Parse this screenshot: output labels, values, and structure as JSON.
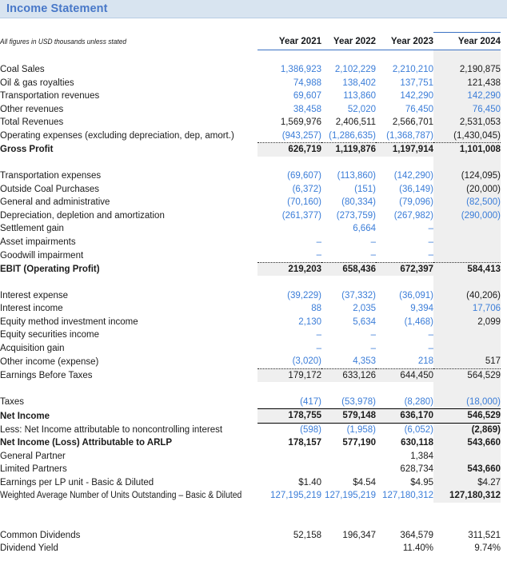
{
  "header": {
    "title": "Income Statement",
    "note": "All figures in USD thousands unless stated",
    "columns": [
      "Year 2021",
      "Year 2022",
      "Year 2023",
      "Year 2024"
    ]
  },
  "colors": {
    "title_text": "#4878c8",
    "title_band": "#d8e4f0",
    "linked_value": "#3b7dd8",
    "hardcoded_value": "#1b1b1b",
    "shading": "#efefef",
    "header_rule": "#3b72c4"
  },
  "rows": [
    {
      "label": "Coal Sales",
      "values": [
        "1,386,923",
        "2,102,229",
        "2,210,210",
        "2,190,875"
      ],
      "value_colors": [
        "blue",
        "blue",
        "blue",
        "black"
      ]
    },
    {
      "label": "Oil & gas royalties",
      "values": [
        "74,988",
        "138,402",
        "137,751",
        "121,438"
      ],
      "value_colors": [
        "blue",
        "blue",
        "blue",
        "black"
      ]
    },
    {
      "label": "Transportation revenues",
      "values": [
        "69,607",
        "113,860",
        "142,290",
        "142,290"
      ],
      "value_colors": [
        "blue",
        "blue",
        "blue",
        "blue"
      ]
    },
    {
      "label": "Other revenues",
      "values": [
        "38,458",
        "52,020",
        "76,450",
        "76,450"
      ],
      "value_colors": [
        "blue",
        "blue",
        "blue",
        "blue"
      ]
    },
    {
      "label": "Total Revenues",
      "values": [
        "1,569,976",
        "2,406,511",
        "2,566,701",
        "2,531,053"
      ],
      "value_colors": [
        "black",
        "black",
        "black",
        "black"
      ]
    },
    {
      "label": "Operating expenses (excluding depreciation, dep, amort.)",
      "values": [
        "(943,257)",
        "(1,286,635)",
        "(1,368,787)",
        "(1,430,045)"
      ],
      "value_colors": [
        "blue",
        "blue",
        "blue",
        "black"
      ]
    },
    {
      "label": "Gross Profit",
      "values": [
        "626,719",
        "1,119,876",
        "1,197,914",
        "1,101,008"
      ],
      "value_colors": [
        "black",
        "black",
        "black",
        "black"
      ]
    },
    {
      "label": "Transportation expenses",
      "values": [
        "(69,607)",
        "(113,860)",
        "(142,290)",
        "(124,095)"
      ],
      "value_colors": [
        "blue",
        "blue",
        "blue",
        "black"
      ]
    },
    {
      "label": "Outside Coal Purchases",
      "values": [
        "(6,372)",
        "(151)",
        "(36,149)",
        "(20,000)"
      ],
      "value_colors": [
        "blue",
        "blue",
        "blue",
        "black"
      ]
    },
    {
      "label": "General and administrative",
      "values": [
        "(70,160)",
        "(80,334)",
        "(79,096)",
        "(82,500)"
      ],
      "value_colors": [
        "blue",
        "blue",
        "blue",
        "blue"
      ]
    },
    {
      "label": "Depreciation, depletion and amortization",
      "values": [
        "(261,377)",
        "(273,759)",
        "(267,982)",
        "(290,000)"
      ],
      "value_colors": [
        "blue",
        "blue",
        "blue",
        "blue"
      ]
    },
    {
      "label": "Settlement gain",
      "values": [
        "",
        "6,664",
        "–",
        ""
      ],
      "value_colors": [
        "blue",
        "blue",
        "blue",
        "black"
      ]
    },
    {
      "label": "Asset impairments",
      "values": [
        "–",
        "–",
        "–",
        ""
      ],
      "value_colors": [
        "blue",
        "blue",
        "blue",
        "black"
      ]
    },
    {
      "label": "Goodwill impairment",
      "values": [
        "–",
        "–",
        "–",
        ""
      ],
      "value_colors": [
        "blue",
        "blue",
        "blue",
        "black"
      ]
    },
    {
      "label": "EBIT (Operating Profit)",
      "values": [
        "219,203",
        "658,436",
        "672,397",
        "584,413"
      ],
      "value_colors": [
        "black",
        "black",
        "black",
        "black"
      ]
    },
    {
      "label": "Interest expense",
      "values": [
        "(39,229)",
        "(37,332)",
        "(36,091)",
        "(40,206)"
      ],
      "value_colors": [
        "blue",
        "blue",
        "blue",
        "black"
      ]
    },
    {
      "label": "Interest income",
      "values": [
        "88",
        "2,035",
        "9,394",
        "17,706"
      ],
      "value_colors": [
        "blue",
        "blue",
        "blue",
        "blue"
      ]
    },
    {
      "label": "Equity method investment income",
      "values": [
        "2,130",
        "5,634",
        "(1,468)",
        "2,099"
      ],
      "value_colors": [
        "blue",
        "blue",
        "blue",
        "black"
      ]
    },
    {
      "label": "Equity securities income",
      "values": [
        "–",
        "–",
        "–",
        ""
      ],
      "value_colors": [
        "blue",
        "blue",
        "blue",
        "black"
      ]
    },
    {
      "label": "Acquisition gain",
      "values": [
        "–",
        "–",
        "–",
        ""
      ],
      "value_colors": [
        "blue",
        "blue",
        "blue",
        "black"
      ]
    },
    {
      "label": "Other income (expense)",
      "values": [
        "(3,020)",
        "4,353",
        "218",
        "517"
      ],
      "value_colors": [
        "blue",
        "blue",
        "blue",
        "black"
      ]
    },
    {
      "label": "Earnings Before Taxes",
      "values": [
        "179,172",
        "633,126",
        "644,450",
        "564,529"
      ],
      "value_colors": [
        "black",
        "black",
        "black",
        "black"
      ]
    },
    {
      "label": "Taxes",
      "values": [
        "(417)",
        "(53,978)",
        "(8,280)",
        "(18,000)"
      ],
      "value_colors": [
        "blue",
        "blue",
        "blue",
        "blue"
      ]
    },
    {
      "label": "Net Income",
      "values": [
        "178,755",
        "579,148",
        "636,170",
        "546,529"
      ],
      "value_colors": [
        "black",
        "black",
        "black",
        "black"
      ]
    },
    {
      "label": "Less: Net Income attributable to noncontrolling interest",
      "values": [
        "(598)",
        "(1,958)",
        "(6,052)",
        "(2,869)"
      ],
      "value_colors": [
        "blue",
        "blue",
        "blue",
        "black"
      ]
    },
    {
      "label": "Net Income (Loss) Attributable to ARLP",
      "values": [
        "178,157",
        "577,190",
        "630,118",
        "543,660"
      ],
      "value_colors": [
        "black",
        "black",
        "black",
        "black"
      ]
    },
    {
      "label": "General Partner",
      "values": [
        "",
        "",
        "1,384",
        ""
      ],
      "value_colors": [
        "black",
        "black",
        "black",
        "black"
      ]
    },
    {
      "label": "Limited Partners",
      "values": [
        "",
        "",
        "628,734",
        "543,660"
      ],
      "value_colors": [
        "black",
        "black",
        "black",
        "black"
      ]
    },
    {
      "label": "Earnings per LP unit - Basic & Diluted",
      "values": [
        "$1.40",
        "$4.54",
        "$4.95",
        "$4.27"
      ],
      "value_colors": [
        "black",
        "black",
        "black",
        "black"
      ]
    },
    {
      "label": "Weighted Average Number of Units Outstanding – Basic & Diluted",
      "values": [
        "127,195,219",
        "127,195,219",
        "127,180,312",
        "127,180,312"
      ],
      "value_colors": [
        "blue",
        "blue",
        "blue",
        "black"
      ]
    },
    {
      "label": "Common Dividends",
      "values": [
        "52,158",
        "196,347",
        "364,579",
        "311,521"
      ],
      "value_colors": [
        "black",
        "black",
        "black",
        "black"
      ]
    },
    {
      "label": "Dividend Yield",
      "values": [
        "",
        "",
        "11.40%",
        "9.74%"
      ],
      "value_colors": [
        "black",
        "black",
        "black",
        "black"
      ]
    }
  ]
}
